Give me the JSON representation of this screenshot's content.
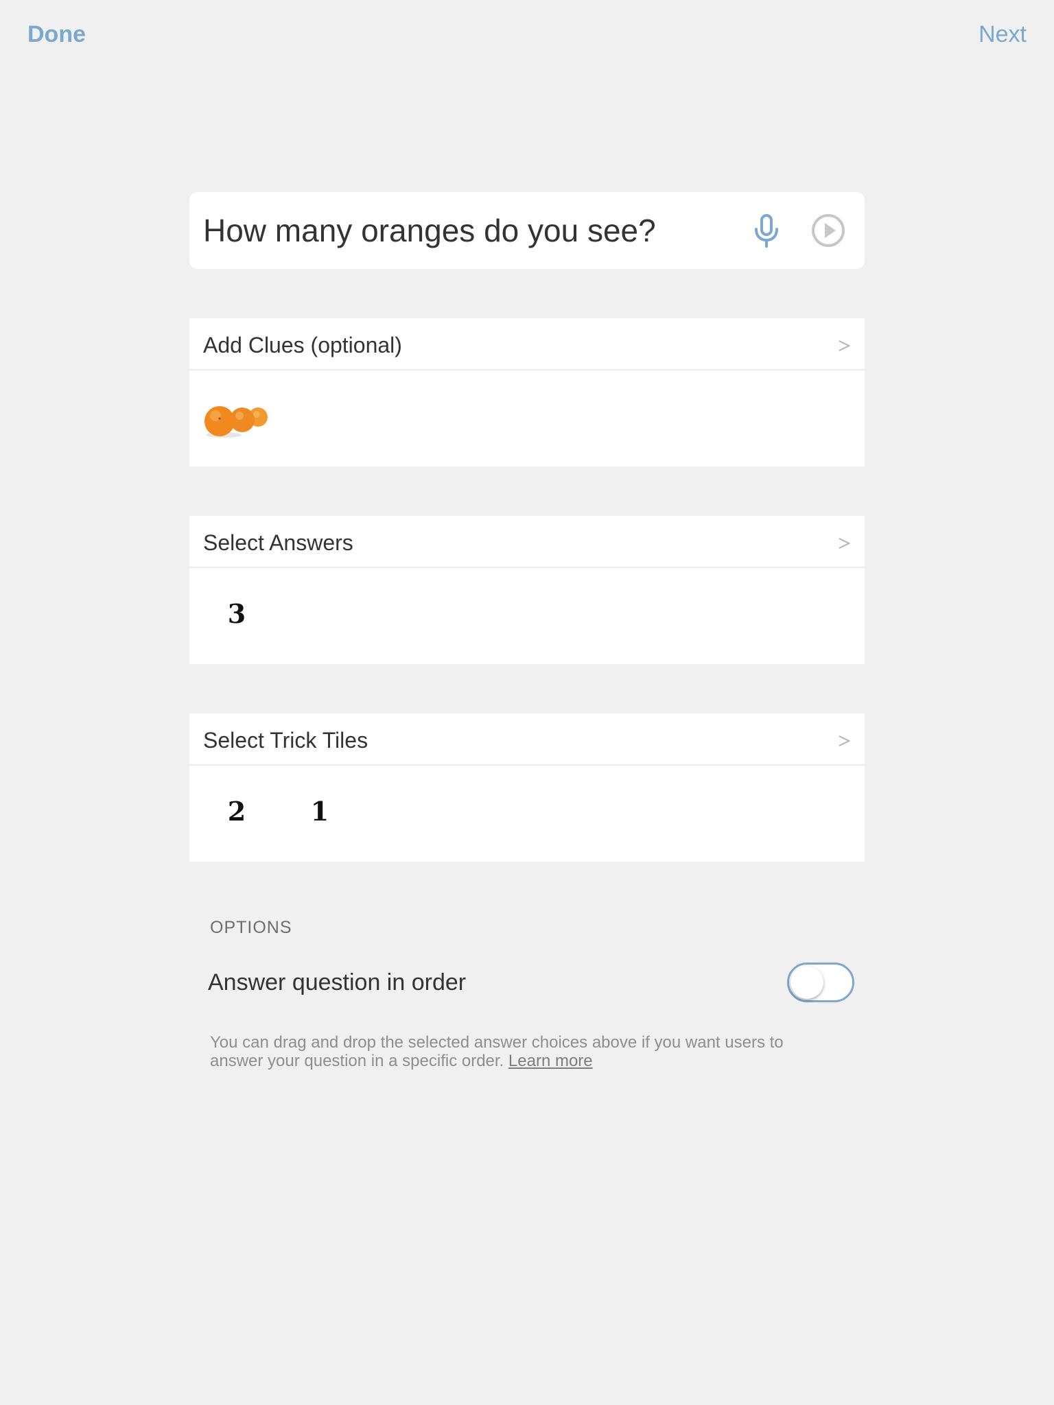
{
  "nav": {
    "done_label": "Done",
    "next_label": "Next"
  },
  "question": {
    "text": "How many oranges do you see?",
    "mic_icon": "microphone-icon",
    "play_icon": "play-circle-icon"
  },
  "clues": {
    "title": "Add Clues (optional)",
    "image_icon": "oranges-image"
  },
  "answers": {
    "title": "Select Answers",
    "tiles": [
      "3"
    ]
  },
  "trick_tiles": {
    "title": "Select Trick Tiles",
    "tiles": [
      "2",
      "1"
    ]
  },
  "options": {
    "heading": "OPTIONS",
    "order_label": "Answer question in order",
    "order_enabled": false,
    "help_text": "You can drag and drop the selected answer choices above if you want users to answer your question in a specific order.",
    "learn_more": "Learn more"
  },
  "colors": {
    "accent": "#7aa8cf",
    "background": "#f0f0f0",
    "card": "#ffffff",
    "orange": "#f28c28"
  }
}
